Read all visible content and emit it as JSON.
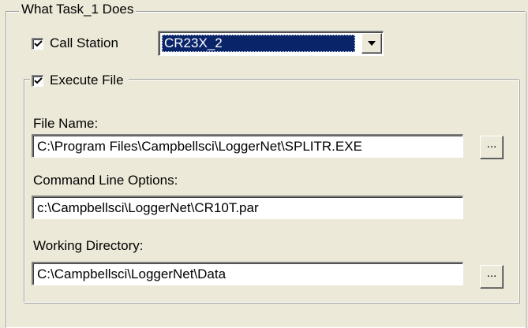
{
  "group": {
    "title": "What Task_1 Does"
  },
  "call_station": {
    "label": "Call Station",
    "checked": true,
    "selected": "CR23X_2"
  },
  "execute_file": {
    "label": "Execute File",
    "checked": true,
    "file_name_label": "File Name:",
    "file_name_value": "C:\\Program Files\\Campbellsci\\LoggerNet\\SPLITR.EXE",
    "cmd_label": "Command Line Options:",
    "cmd_value": "c:\\Campbellsci\\LoggerNet\\CR10T.par",
    "workdir_label": "Working Directory:",
    "workdir_value": "C:\\Campbellsci\\LoggerNet\\Data",
    "browse_label": "..."
  },
  "icons": {
    "checkbox_mark": "check-icon",
    "dropdown_arrow": "chevron-down-icon"
  }
}
